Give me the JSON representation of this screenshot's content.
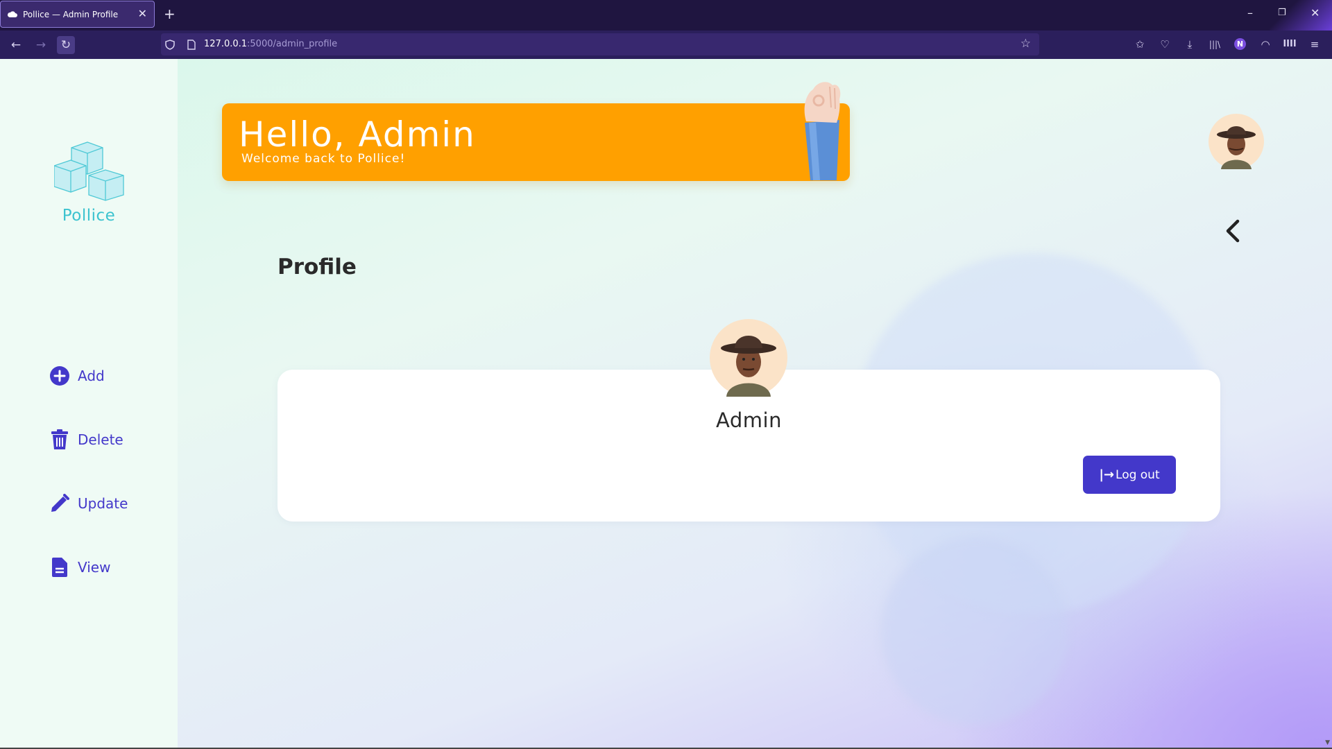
{
  "browser": {
    "tab_title": "Pollice — Admin Profile",
    "url_host": "127.0.0.1",
    "url_path": ":5000/admin_profile"
  },
  "sidebar": {
    "brand": "Pollice",
    "items": [
      {
        "label": "Add",
        "icon": "plus-circle-icon"
      },
      {
        "label": "Delete",
        "icon": "trash-icon"
      },
      {
        "label": "Update",
        "icon": "pencil-icon"
      },
      {
        "label": "View",
        "icon": "document-icon"
      }
    ]
  },
  "banner": {
    "title": "Hello, Admin",
    "subtitle": "Welcome back to Pollice!"
  },
  "main": {
    "heading": "Profile",
    "profile_name": "Admin",
    "logout_label": "Log out"
  },
  "colors": {
    "accent": "#4338ca",
    "banner": "#ffa000",
    "brand": "#3cc3cf"
  }
}
